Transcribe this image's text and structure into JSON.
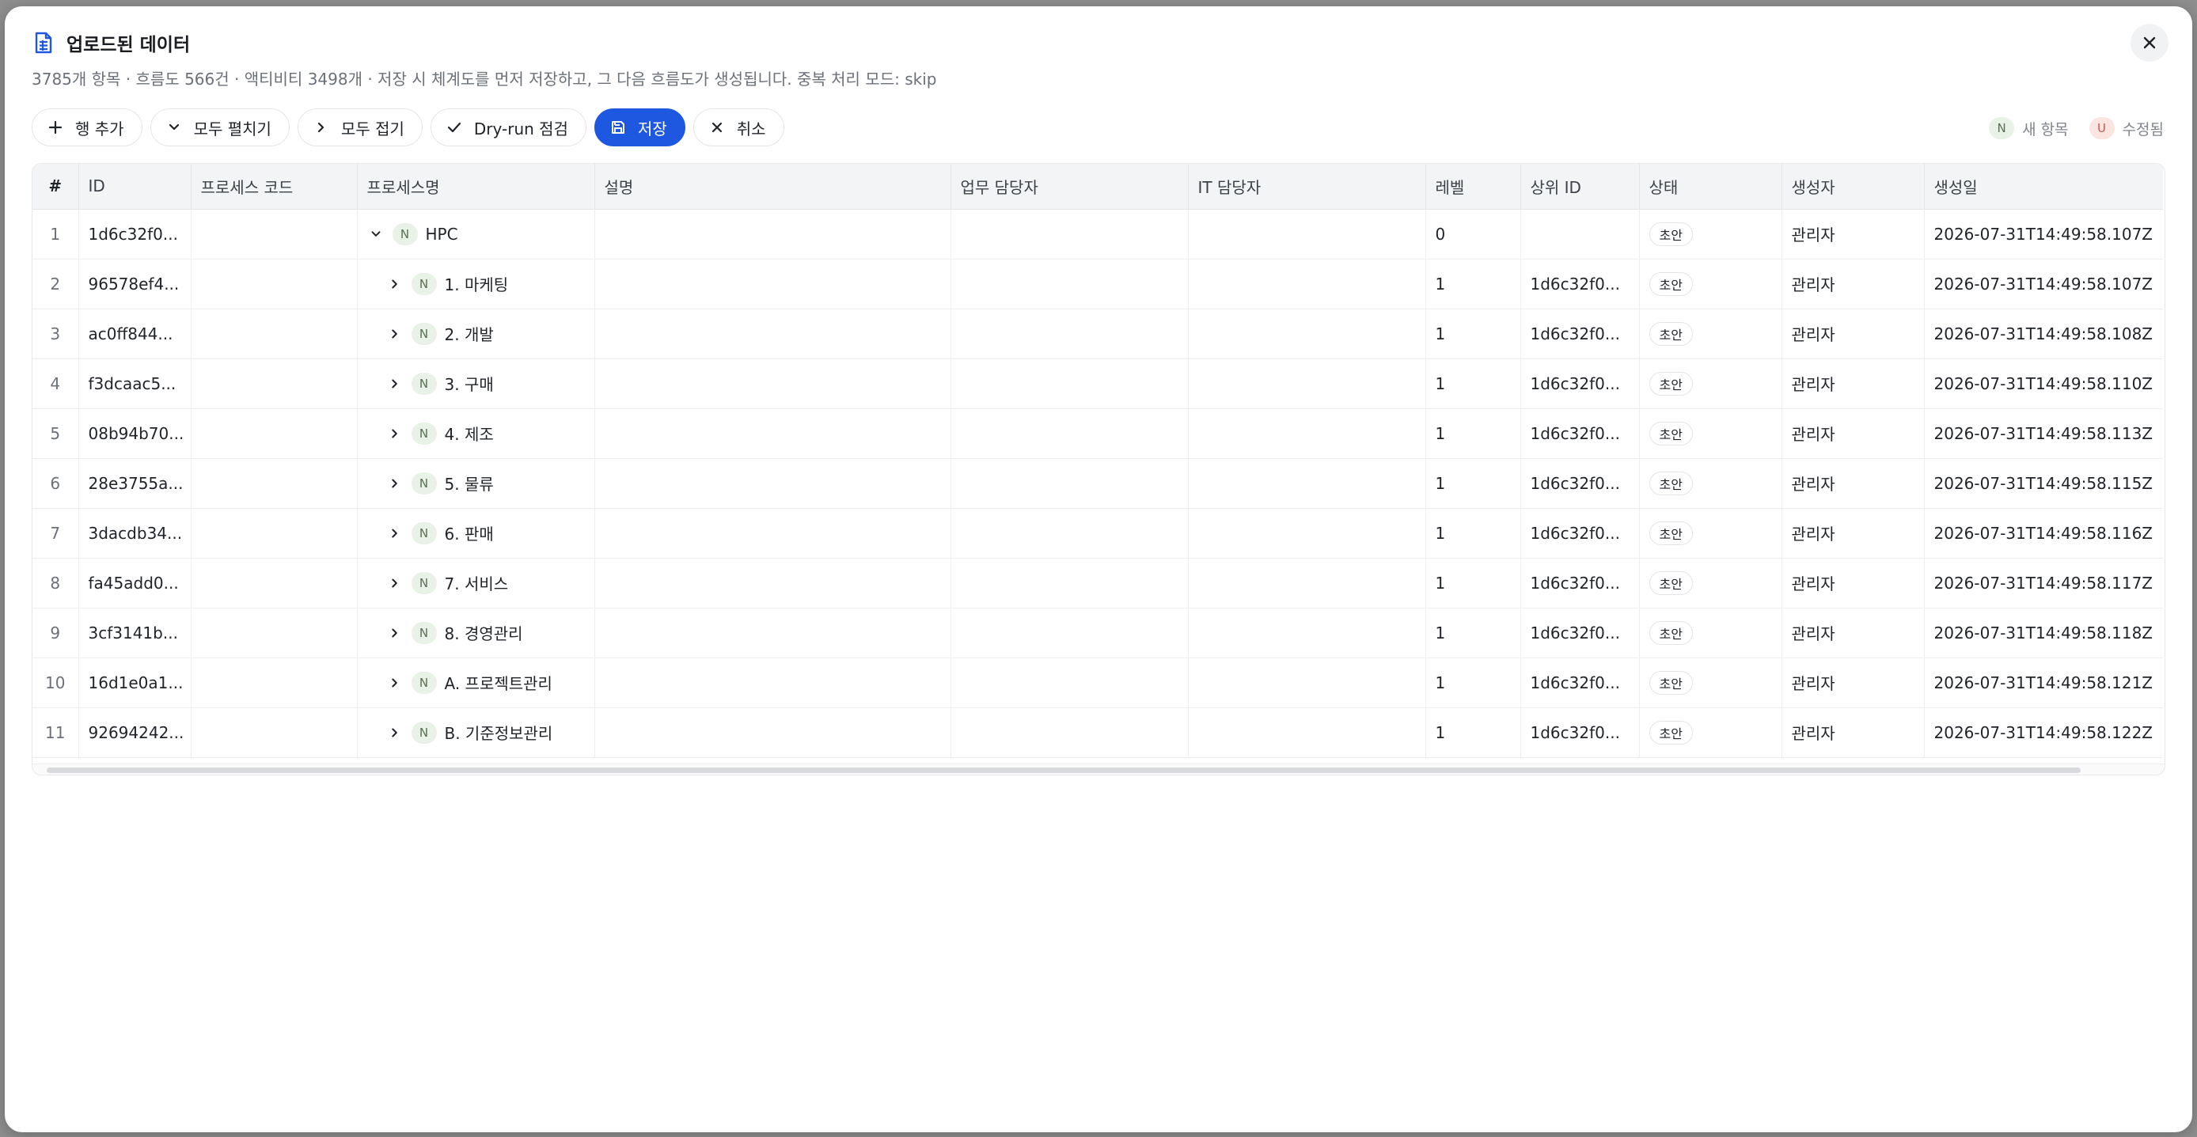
{
  "header": {
    "title": "업로드된 데이터",
    "subtitle": "3785개 항목 · 흐름도 566건 · 액티비티 3498개 · 저장 시 체계도를 먼저 저장하고, 그 다음 흐름도가 생성됩니다. 중복 처리 모드: skip",
    "title_icon": "file-spreadsheet-icon",
    "close_icon": "close-icon"
  },
  "toolbar": {
    "add_row": "행 추가",
    "expand_all": "모두 펼치기",
    "collapse_all": "모두 접기",
    "dry_run": "Dry-run 점검",
    "save": "저장",
    "cancel": "취소"
  },
  "legend": {
    "new_badge": "N",
    "new_label": "새 항목",
    "updated_badge": "U",
    "updated_label": "수정됨"
  },
  "colors": {
    "primary": "#1f58e0",
    "new_badge_bg": "#e8f2e6",
    "updated_badge_bg": "#fce4e1"
  },
  "table": {
    "columns": [
      "#",
      "ID",
      "프로세스 코드",
      "프로세스명",
      "설명",
      "업무 담당자",
      "IT 담당자",
      "레벨",
      "상위 ID",
      "상태",
      "생성자",
      "생성일"
    ],
    "rows": [
      {
        "num": "1",
        "id": "1d6c32f0...",
        "code": "",
        "expanded": true,
        "indent": 0,
        "badge": "N",
        "name": "HPC",
        "desc": "",
        "biz": "",
        "it": "",
        "level": "0",
        "parent": "",
        "status": "초안",
        "creator": "관리자",
        "created": "2026-07-31T14:49:58.107Z"
      },
      {
        "num": "2",
        "id": "96578ef4...",
        "code": "",
        "expanded": false,
        "indent": 1,
        "badge": "N",
        "name": "1. 마케팅",
        "desc": "",
        "biz": "",
        "it": "",
        "level": "1",
        "parent": "1d6c32f0...",
        "status": "초안",
        "creator": "관리자",
        "created": "2026-07-31T14:49:58.107Z"
      },
      {
        "num": "3",
        "id": "ac0ff844...",
        "code": "",
        "expanded": false,
        "indent": 1,
        "badge": "N",
        "name": "2. 개발",
        "desc": "",
        "biz": "",
        "it": "",
        "level": "1",
        "parent": "1d6c32f0...",
        "status": "초안",
        "creator": "관리자",
        "created": "2026-07-31T14:49:58.108Z"
      },
      {
        "num": "4",
        "id": "f3dcaac5...",
        "code": "",
        "expanded": false,
        "indent": 1,
        "badge": "N",
        "name": "3. 구매",
        "desc": "",
        "biz": "",
        "it": "",
        "level": "1",
        "parent": "1d6c32f0...",
        "status": "초안",
        "creator": "관리자",
        "created": "2026-07-31T14:49:58.110Z"
      },
      {
        "num": "5",
        "id": "08b94b70...",
        "code": "",
        "expanded": false,
        "indent": 1,
        "badge": "N",
        "name": "4. 제조",
        "desc": "",
        "biz": "",
        "it": "",
        "level": "1",
        "parent": "1d6c32f0...",
        "status": "초안",
        "creator": "관리자",
        "created": "2026-07-31T14:49:58.113Z"
      },
      {
        "num": "6",
        "id": "28e3755a...",
        "code": "",
        "expanded": false,
        "indent": 1,
        "badge": "N",
        "name": "5. 물류",
        "desc": "",
        "biz": "",
        "it": "",
        "level": "1",
        "parent": "1d6c32f0...",
        "status": "초안",
        "creator": "관리자",
        "created": "2026-07-31T14:49:58.115Z"
      },
      {
        "num": "7",
        "id": "3dacdb34...",
        "code": "",
        "expanded": false,
        "indent": 1,
        "badge": "N",
        "name": "6. 판매",
        "desc": "",
        "biz": "",
        "it": "",
        "level": "1",
        "parent": "1d6c32f0...",
        "status": "초안",
        "creator": "관리자",
        "created": "2026-07-31T14:49:58.116Z"
      },
      {
        "num": "8",
        "id": "fa45add0...",
        "code": "",
        "expanded": false,
        "indent": 1,
        "badge": "N",
        "name": "7. 서비스",
        "desc": "",
        "biz": "",
        "it": "",
        "level": "1",
        "parent": "1d6c32f0...",
        "status": "초안",
        "creator": "관리자",
        "created": "2026-07-31T14:49:58.117Z"
      },
      {
        "num": "9",
        "id": "3cf3141b...",
        "code": "",
        "expanded": false,
        "indent": 1,
        "badge": "N",
        "name": "8. 경영관리",
        "desc": "",
        "biz": "",
        "it": "",
        "level": "1",
        "parent": "1d6c32f0...",
        "status": "초안",
        "creator": "관리자",
        "created": "2026-07-31T14:49:58.118Z"
      },
      {
        "num": "10",
        "id": "16d1e0a1...",
        "code": "",
        "expanded": false,
        "indent": 1,
        "badge": "N",
        "name": "A. 프로젝트관리",
        "desc": "",
        "biz": "",
        "it": "",
        "level": "1",
        "parent": "1d6c32f0...",
        "status": "초안",
        "creator": "관리자",
        "created": "2026-07-31T14:49:58.121Z"
      },
      {
        "num": "11",
        "id": "92694242...",
        "code": "",
        "expanded": false,
        "indent": 1,
        "badge": "N",
        "name": "B. 기준정보관리",
        "desc": "",
        "biz": "",
        "it": "",
        "level": "1",
        "parent": "1d6c32f0...",
        "status": "초안",
        "creator": "관리자",
        "created": "2026-07-31T14:49:58.122Z"
      }
    ]
  }
}
